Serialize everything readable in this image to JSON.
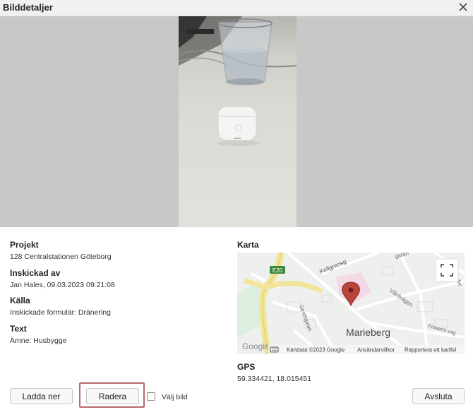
{
  "dialog": {
    "title": "Bilddetaljer"
  },
  "details": {
    "project_label": "Projekt",
    "project_value": "128 Centralstationen Göteborg",
    "sent_by_label": "Inskickad av",
    "sent_by_value": "Jan Hales, 09.03.2023 09:21:08",
    "source_label": "Källa",
    "source_value": "Inskickade formulär: Dränering",
    "text_label": "Text",
    "text_value": "Ämne: Husbygge"
  },
  "map": {
    "label": "Karta",
    "road_labels": {
      "e20": "E20",
      "kellgren": "Kellgrensg",
      "gatan": "gatan",
      "vardvagen": "Vårdvägen",
      "welander": "Welander",
      "gerdsgatan": "Gerdsgatan",
      "finsens": "Finsens vag"
    },
    "place_label": "Marieberg",
    "logo": "Google",
    "attribution": "Kartdata ©2023 Google",
    "terms": "Användarvillkor",
    "report": "Rapportera ett kartfel"
  },
  "gps": {
    "label": "GPS",
    "value": "59.334421, 18.015451"
  },
  "actions": {
    "download": "Ladda ner",
    "delete": "Radera",
    "select": "Välj bild",
    "close": "Avsluta"
  }
}
